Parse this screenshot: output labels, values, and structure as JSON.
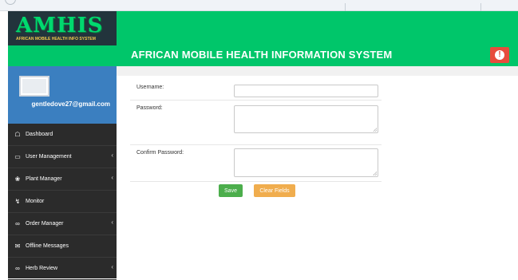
{
  "header": {
    "logo": "AMHIS",
    "logo_tagline": "AFRICAN MOBILE HEALTH INFO SYSTEM",
    "title": "AFRICAN MOBILE HEALTH INFORMATION SYSTEM",
    "alert_icon": "exclamation-circle-icon",
    "accent_color": "#00c66a"
  },
  "profile": {
    "email": "gentledove27@gmail.com"
  },
  "sidebar": {
    "items": [
      {
        "label": "Dashboard",
        "icon": "dashboard-icon"
      },
      {
        "label": "User Management",
        "icon": "desktop-icon"
      },
      {
        "label": "Plant Manager",
        "icon": "plant-icon"
      },
      {
        "label": "Monitor",
        "icon": "bolt-icon"
      },
      {
        "label": "Order Manager",
        "icon": "bicycle-icon"
      },
      {
        "label": "Offline Messages",
        "icon": "envelope-icon"
      },
      {
        "label": "Herb Review",
        "icon": "bicycle-icon"
      }
    ]
  },
  "form": {
    "username_label": "Username:",
    "username_value": "",
    "password_label": "Password:",
    "password_value": "",
    "confirm_label": "Confirm Password:",
    "confirm_value": "",
    "save_label": "Save",
    "clear_label": "Clear Fields"
  }
}
